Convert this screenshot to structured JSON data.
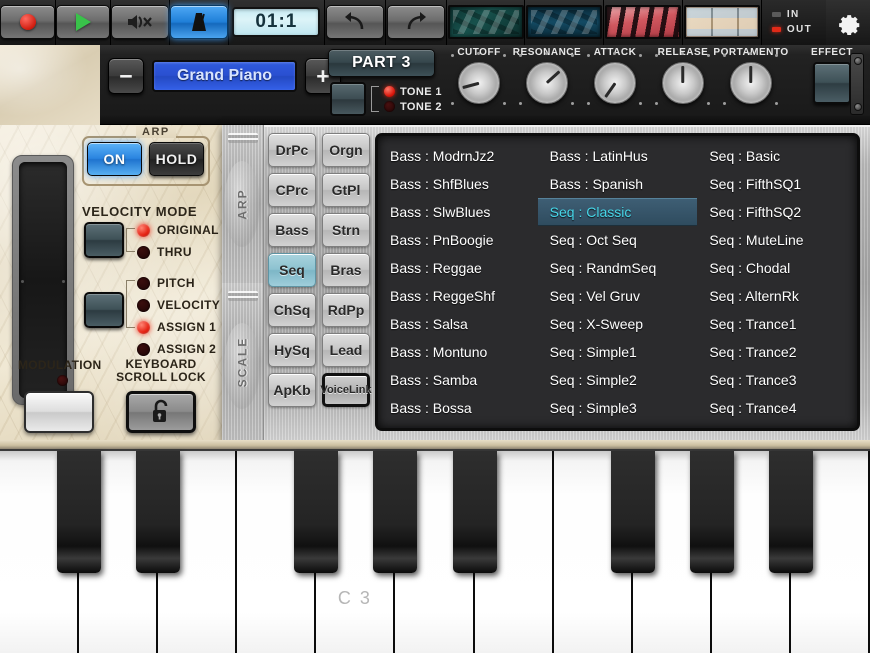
{
  "toolbar": {
    "record_icon": "record-dot-icon",
    "play_icon": "play-triangle-icon",
    "mute_icon": "speaker-mute-icon",
    "metronome_icon": "metronome-icon",
    "tempo_display": "01:1",
    "undo_icon": "undo-arrow-icon",
    "redo_icon": "redo-arrow-icon",
    "thumb_mixer": "mixer-view-icon",
    "thumb_sequencer": "sequencer-view-icon",
    "thumb_keyboard": "keyboard-view-icon",
    "thumb_pads": "pads-view-icon",
    "in_label": "IN",
    "out_label": "OUT",
    "settings_icon": "gear-icon"
  },
  "synth": {
    "minus_label": "−",
    "plus_label": "+",
    "patch_name": "Grand Piano",
    "part_label": "PART 3",
    "tone1_label": "TONE 1",
    "tone2_label": "TONE 2",
    "knobs": [
      {
        "label": "CUTOFF",
        "angle": -105
      },
      {
        "label": "RESONANCE",
        "angle": 48
      },
      {
        "label": "ATTACK",
        "angle": -145
      },
      {
        "label": "RELEASE",
        "angle": 0
      },
      {
        "label": "PORTAMENTO",
        "angle": 0
      }
    ],
    "effect_label": "EFFECT"
  },
  "left_panel": {
    "arp_title": "ARP",
    "arp_on_label": "ON",
    "arp_hold_label": "HOLD",
    "velocity_mode_title": "VELOCITY MODE",
    "velocity_modes": [
      {
        "label": "ORIGINAL",
        "on": true
      },
      {
        "label": "THRU",
        "on": false
      }
    ],
    "assign_modes": [
      {
        "label": "PITCH",
        "on": false
      },
      {
        "label": "VELOCITY",
        "on": false
      },
      {
        "label": "ASSIGN 1",
        "on": true
      },
      {
        "label": "ASSIGN 2",
        "on": false
      }
    ],
    "modulation_label": "MODULATION",
    "keyboard_scroll_lock_label": "KEYBOARD\nSCROLL LOCK",
    "lock_icon": "padlock-unlocked-icon"
  },
  "arp_panel": {
    "tabs": [
      {
        "label": "ARP",
        "active": true
      },
      {
        "label": "SCALE",
        "active": false
      }
    ],
    "categories": [
      {
        "label": "DrPc",
        "selected": false
      },
      {
        "label": "Orgn",
        "selected": false
      },
      {
        "label": "CPrc",
        "selected": false
      },
      {
        "label": "GtPl",
        "selected": false
      },
      {
        "label": "Bass",
        "selected": false
      },
      {
        "label": "Strn",
        "selected": false
      },
      {
        "label": "Seq",
        "selected": true
      },
      {
        "label": "Bras",
        "selected": false
      },
      {
        "label": "ChSq",
        "selected": false
      },
      {
        "label": "RdPp",
        "selected": false
      },
      {
        "label": "HySq",
        "selected": false
      },
      {
        "label": "Lead",
        "selected": false
      },
      {
        "label": "ApKb",
        "selected": false
      },
      {
        "label": "Voice\nLink",
        "selected": false
      }
    ],
    "preset_columns": [
      [
        {
          "label": "Bass : ModrnJz2",
          "selected": false
        },
        {
          "label": "Bass : ShfBlues",
          "selected": false
        },
        {
          "label": "Bass : SlwBlues",
          "selected": false
        },
        {
          "label": "Bass : PnBoogie",
          "selected": false
        },
        {
          "label": "Bass : Reggae",
          "selected": false
        },
        {
          "label": "Bass : ReggeShf",
          "selected": false
        },
        {
          "label": "Bass : Salsa",
          "selected": false
        },
        {
          "label": "Bass : Montuno",
          "selected": false
        },
        {
          "label": "Bass : Samba",
          "selected": false
        },
        {
          "label": "Bass : Bossa",
          "selected": false
        }
      ],
      [
        {
          "label": "Bass : LatinHus",
          "selected": false
        },
        {
          "label": "Bass : Spanish",
          "selected": false
        },
        {
          "label": "Seq : Classic",
          "selected": true
        },
        {
          "label": "Seq : Oct Seq",
          "selected": false
        },
        {
          "label": "Seq : RandmSeq",
          "selected": false
        },
        {
          "label": "Seq : Vel Gruv",
          "selected": false
        },
        {
          "label": "Seq : X-Sweep",
          "selected": false
        },
        {
          "label": "Seq : Simple1",
          "selected": false
        },
        {
          "label": "Seq : Simple2",
          "selected": false
        },
        {
          "label": "Seq : Simple3",
          "selected": false
        }
      ],
      [
        {
          "label": "Seq : Basic",
          "selected": false
        },
        {
          "label": "Seq : FifthSQ1",
          "selected": false
        },
        {
          "label": "Seq : FifthSQ2",
          "selected": false
        },
        {
          "label": "Seq : MuteLine",
          "selected": false
        },
        {
          "label": "Seq : Chodal",
          "selected": false
        },
        {
          "label": "Seq : AlternRk",
          "selected": false
        },
        {
          "label": "Seq : Trance1",
          "selected": false
        },
        {
          "label": "Seq : Trance2",
          "selected": false
        },
        {
          "label": "Seq : Trance3",
          "selected": false
        },
        {
          "label": "Seq : Trance4",
          "selected": false
        }
      ]
    ]
  },
  "keyboard": {
    "white_key_count": 11,
    "octave_label": "C 3",
    "label_key_index": 4,
    "black_key_pattern": [
      true,
      true,
      false,
      true,
      true,
      true,
      false,
      true,
      true,
      true,
      false
    ]
  },
  "colors": {
    "accent_blue": "#2a84e0",
    "selected_teal": "#46d6e8",
    "led_red": "#e31c0d",
    "category_selected": "#8cc2d0"
  }
}
